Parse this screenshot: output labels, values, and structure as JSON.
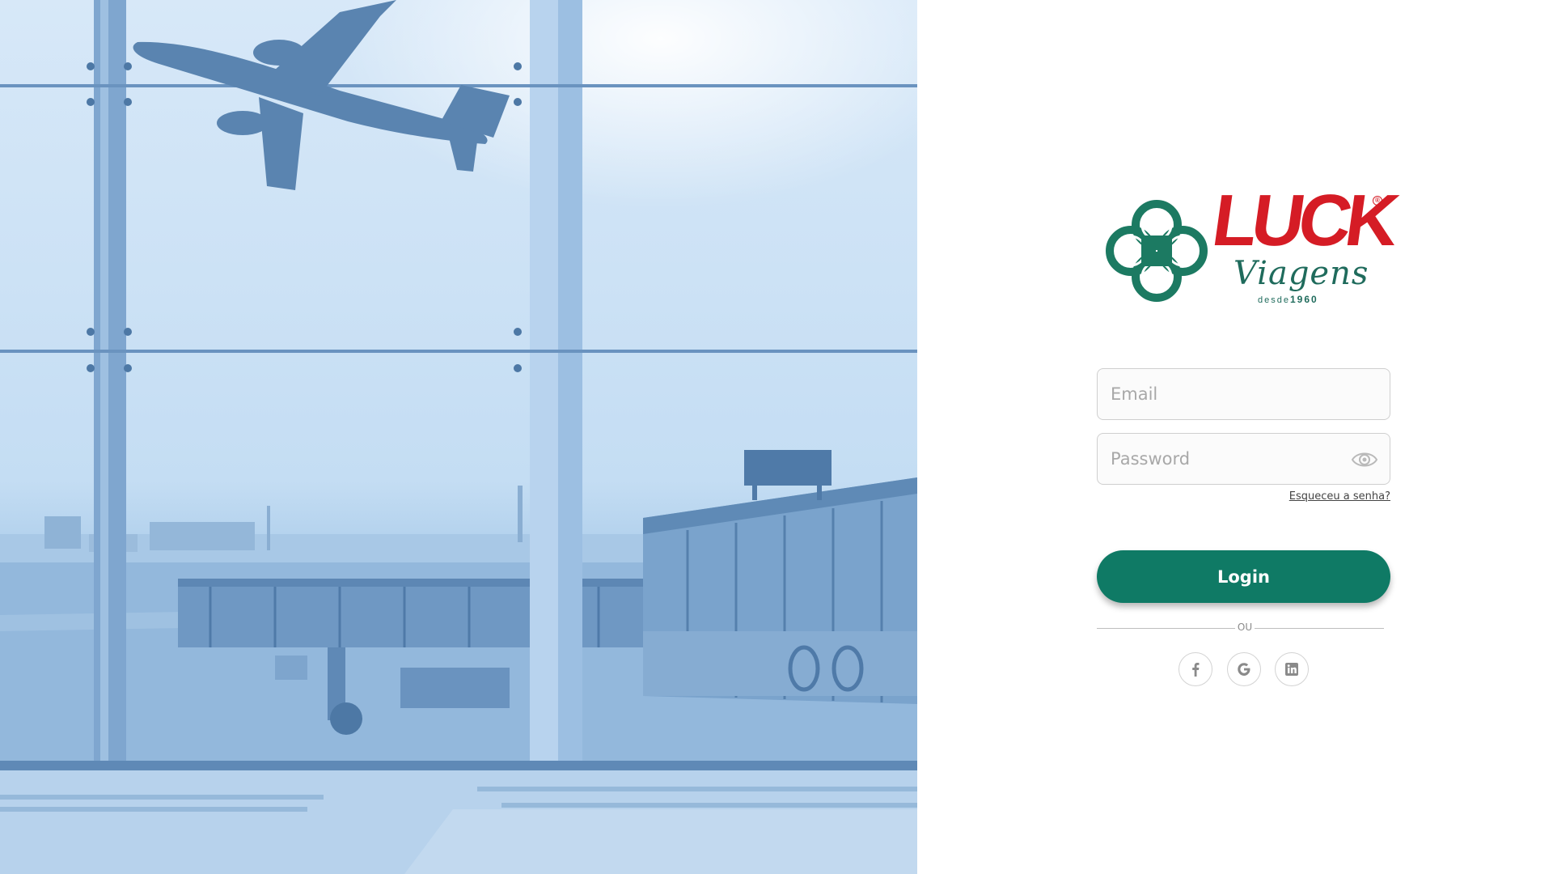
{
  "hero": {
    "scene": "airport-window-airplane-photo"
  },
  "brand": {
    "name": "LUCK",
    "registered_mark": "®",
    "subtitle": "Viagens",
    "since_label": "desde",
    "since_year": "1960",
    "colors": {
      "red": "#d51c25",
      "green": "#1f6b5c"
    }
  },
  "form": {
    "email": {
      "placeholder": "Email",
      "value": ""
    },
    "password": {
      "placeholder": "Password",
      "value": "",
      "toggle_icon": "eye-icon"
    },
    "forgot_label": "Esqueceu a senha?",
    "login_label": "Login",
    "divider_label": "OU"
  },
  "social": [
    {
      "name": "facebook",
      "icon": "facebook-icon"
    },
    {
      "name": "google",
      "icon": "google-icon"
    },
    {
      "name": "linkedin",
      "icon": "linkedin-icon"
    }
  ],
  "colors": {
    "primary": "#0f7a65",
    "hero_tint": "#a9cbea"
  }
}
